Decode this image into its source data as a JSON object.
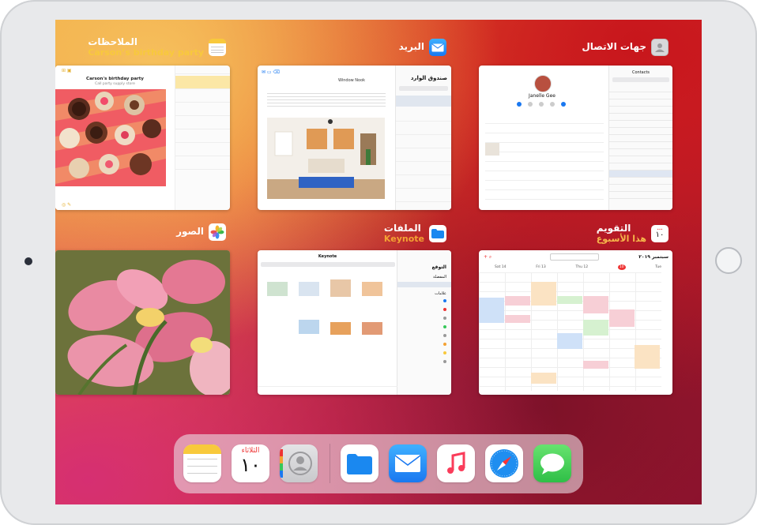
{
  "apps": {
    "contacts": {
      "title": "جهات الاتصال",
      "contact_name": "Janelle Gee",
      "list_title": "Contacts"
    },
    "mail": {
      "title": "البريد",
      "inbox_title": "صندوق الوارد",
      "message_title": "Window Nook"
    },
    "notes": {
      "title": "الملاحظات",
      "subtitle": "Carson’s birthday party",
      "note_title": "Carson's birthday party",
      "note_sub": "Call party supply store"
    },
    "calendar": {
      "title": "التقويم",
      "subtitle": "هذا الأسبوع",
      "icon_day": "١٠",
      "month": "سبتمبر ٢٠١٩",
      "today_num": "10",
      "days": [
        "Tue",
        "Wed",
        "Thu 12",
        "Fri 13",
        "Sat 14"
      ]
    },
    "files": {
      "title": "الملفات",
      "subtitle": "Keynote",
      "header": "Keynote",
      "sidebar": [
        "التوقع",
        "المفضلة",
        "علامات"
      ]
    },
    "photos": {
      "title": "الصور"
    }
  },
  "dock": {
    "calendar_day_name": "الثلاثاء",
    "calendar_day_num": "١٠",
    "icons": [
      "notes-icon",
      "calendar-icon",
      "contacts-icon",
      "files-icon",
      "mail-icon",
      "music-icon",
      "safari-icon",
      "messages-icon"
    ]
  },
  "colors": {
    "notes_accent": "#f8c93c",
    "files_accent": "#f4a233",
    "calendar_accent": "#f6b64a",
    "mail_blue": "#1a8cf6",
    "messages_green": "#36c759"
  }
}
